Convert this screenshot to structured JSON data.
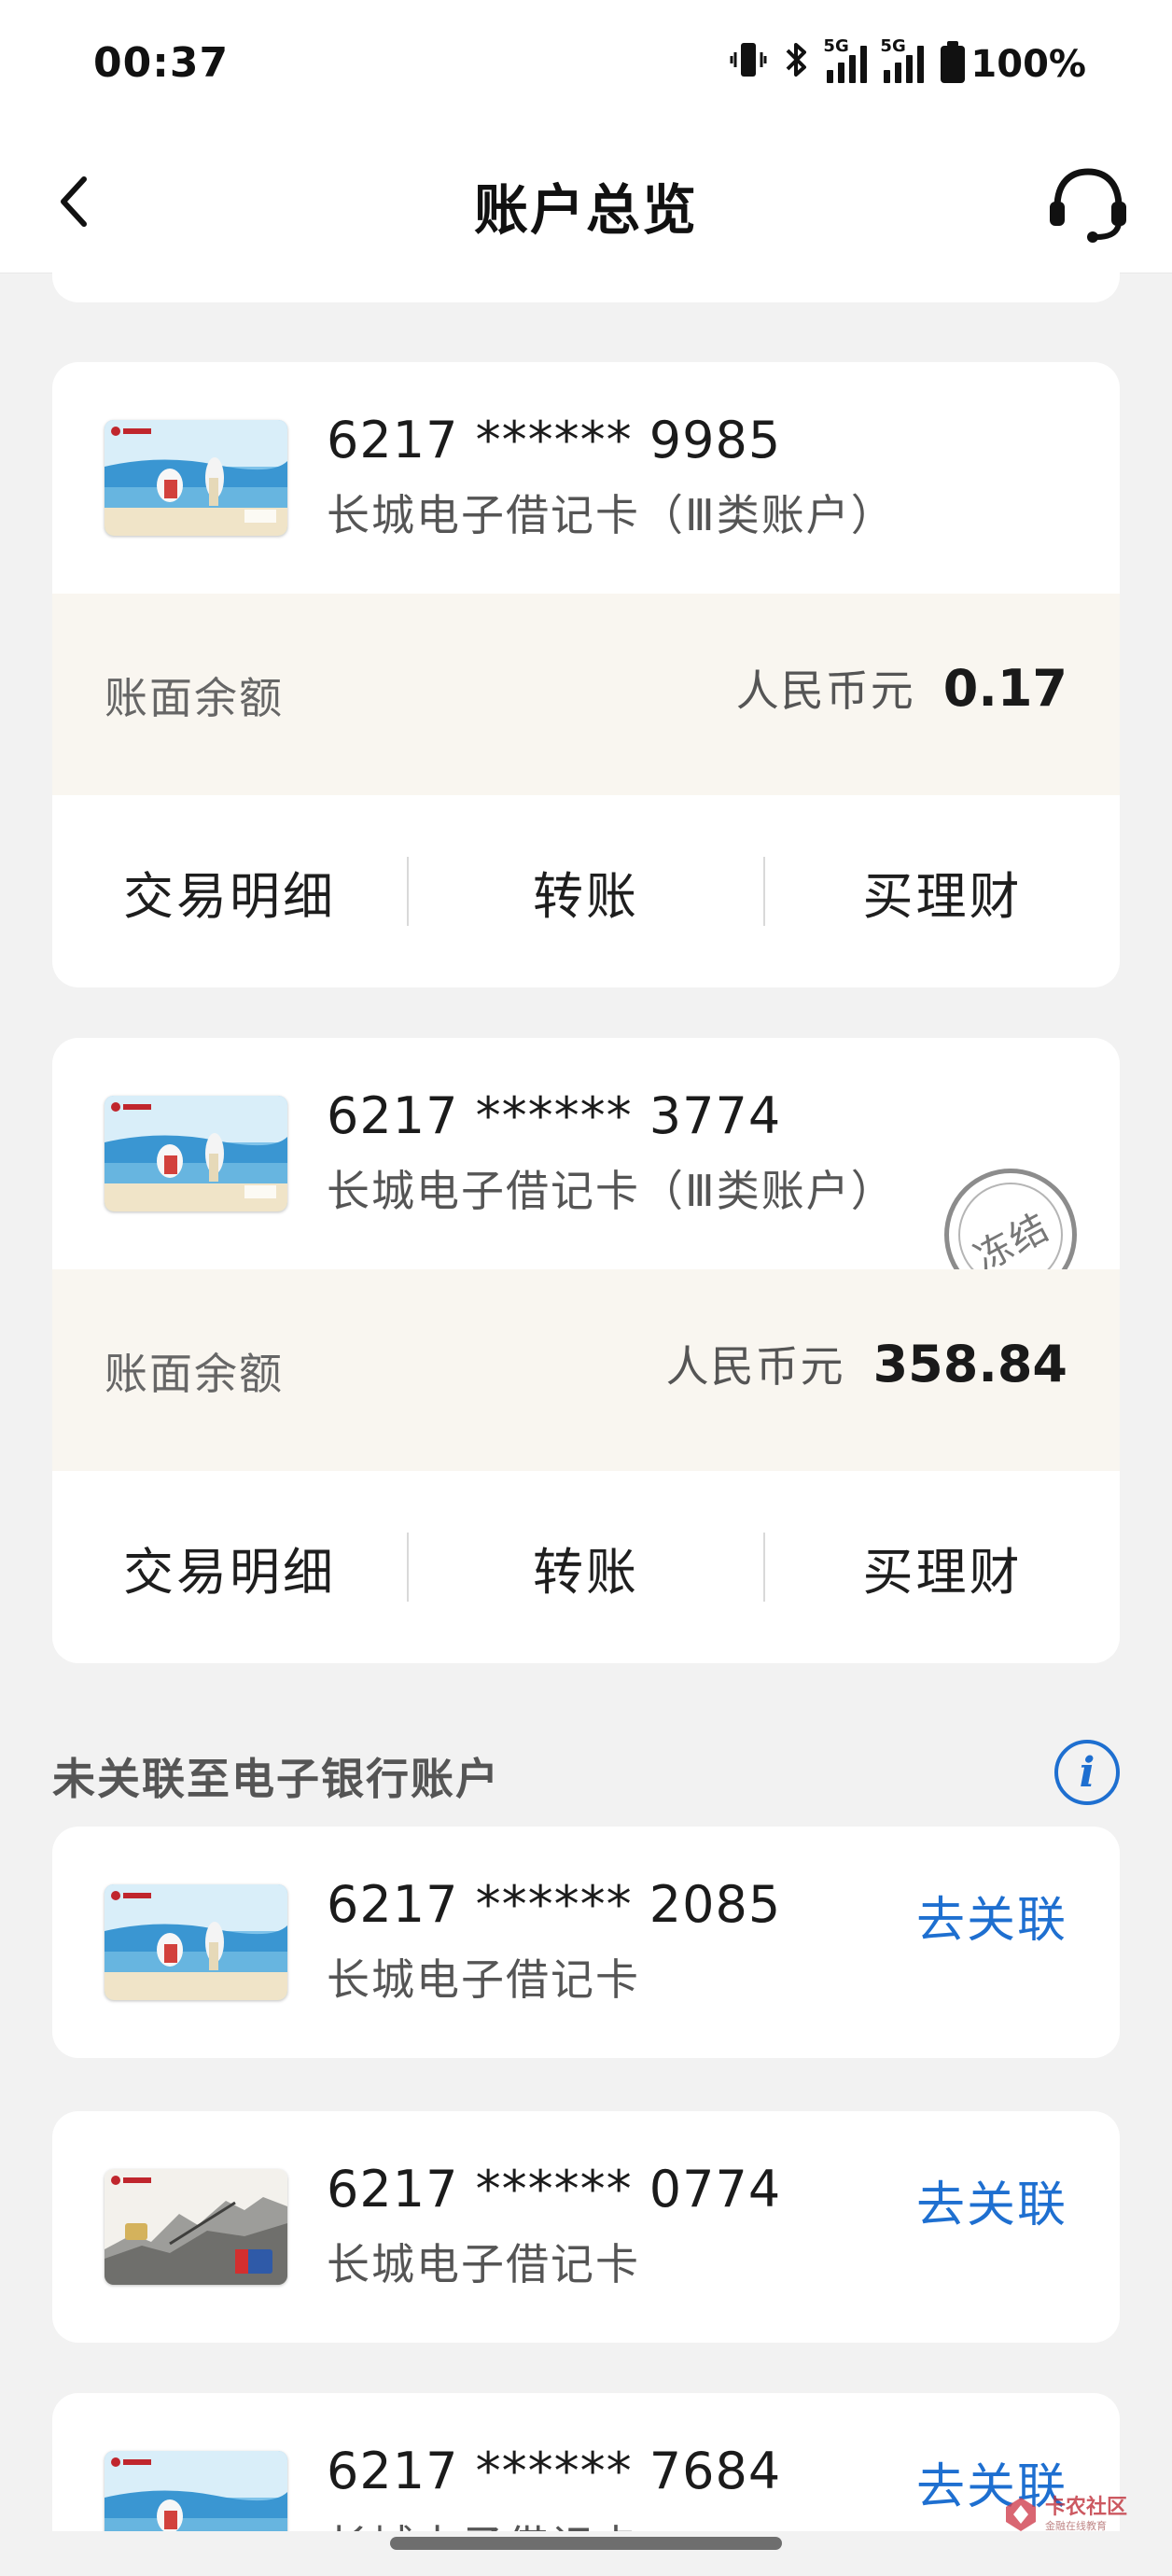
{
  "status_bar": {
    "time": "00:37",
    "battery": "100%",
    "network_1": "5G",
    "network_2": "5G"
  },
  "header": {
    "title": "账户总览",
    "back_icon": "chevron-left-icon",
    "service_icon": "headset-icon"
  },
  "linked_accounts": [
    {
      "number": "6217 ****** 9985",
      "type": "长城电子借记卡（Ⅲ类账户）",
      "balance_label": "账面余额",
      "currency": "人民币元",
      "balance": "0.17",
      "frozen": false,
      "actions": [
        "交易明细",
        "转账",
        "买理财"
      ]
    },
    {
      "number": "6217 ****** 3774",
      "type": "长城电子借记卡（Ⅲ类账户）",
      "balance_label": "账面余额",
      "currency": "人民币元",
      "balance": "358.84",
      "frozen": true,
      "frozen_label": "冻结",
      "actions": [
        "交易明细",
        "转账",
        "买理财"
      ]
    }
  ],
  "unlinked_section": {
    "title": "未关联至电子银行账户",
    "info_icon": "info-icon",
    "accounts": [
      {
        "number": "6217 ****** 2085",
        "type": "长城电子借记卡",
        "link_label": "去关联",
        "card_style": "beach"
      },
      {
        "number": "6217 ****** 0774",
        "type": "长城电子借记卡",
        "link_label": "去关联",
        "card_style": "greatwall"
      },
      {
        "number": "6217 ****** 7684",
        "type": "长城电子借记卡",
        "link_label": "去关联",
        "card_style": "beach"
      }
    ]
  },
  "watermark": {
    "main": "卡农社区",
    "sub": "金融在线教育"
  },
  "colors": {
    "accent": "#1e6fd0",
    "page_bg": "#f2f2f2",
    "balance_bg": "#f9f6f0",
    "text_dark": "#1d1d1d"
  }
}
